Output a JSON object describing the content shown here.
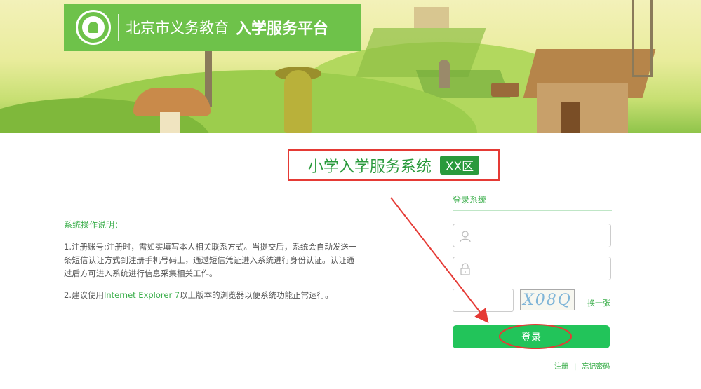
{
  "header": {
    "org_name": "北京市义务教育",
    "platform_name": "入学服务平台"
  },
  "title": {
    "system_name": "小学入学服务系统",
    "district": "XX区"
  },
  "instructions": {
    "heading": "系统操作说明：",
    "item1": "1.注册账号:注册时，需如实填写本人相关联系方式。当提交后，系统会自动发送一条短信认证方式到注册手机号码上，通过短信凭证进入系统进行身份认证。认证通过后方可进入系统进行信息采集相关工作。",
    "item2_prefix": "2.建议使用",
    "item2_browser": "Internet Explorer 7",
    "item2_suffix": "以上版本的浏览器以便系统功能正常运行。"
  },
  "login": {
    "title": "登录系统",
    "username_value": "",
    "password_value": "",
    "captcha_value": "",
    "captcha_text": "X08Q",
    "refresh_label": "换一张",
    "submit_label": "登录",
    "register_label": "注册",
    "separator": "|",
    "forgot_label": "忘记密码"
  },
  "colors": {
    "brand_green": "#6ec24a",
    "button_green": "#22c45a",
    "text_green": "#3aae4a",
    "annotation_red": "#e53a35"
  }
}
